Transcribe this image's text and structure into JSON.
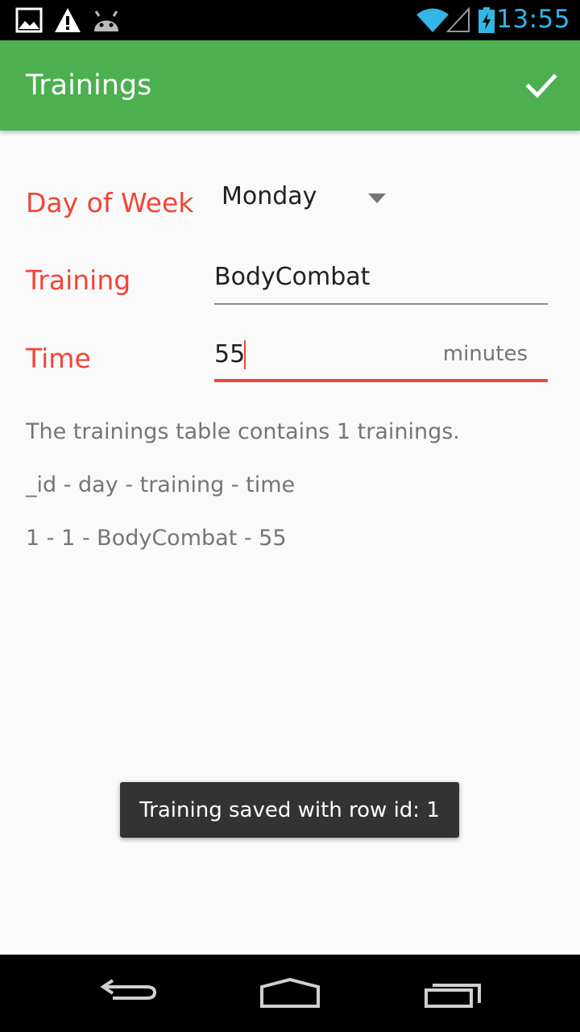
{
  "status_bar": {
    "time": "13:55",
    "icons": [
      "image-icon",
      "warning-icon",
      "android-debug-icon",
      "wifi-icon",
      "signal-icon",
      "battery-charging-icon"
    ],
    "time_color": "#33b5e5"
  },
  "app_bar": {
    "title": "Trainings",
    "color": "#4caf50",
    "save_icon": "checkmark-icon"
  },
  "form": {
    "day_label": "Day of Week",
    "day_value": "Monday",
    "training_label": "Training",
    "training_value": "BodyCombat",
    "time_label": "Time",
    "time_value": "55",
    "time_unit": "minutes",
    "label_color": "#f44336"
  },
  "info": {
    "summary": "The trainings table contains 1 trainings.",
    "header": "_id - day - training - time",
    "rows": [
      "1 - 1 - BodyCombat - 55"
    ]
  },
  "toast": {
    "text": "Training saved with row id: 1"
  },
  "nav_bar": {
    "icons": [
      "back-icon",
      "home-icon",
      "recents-icon"
    ]
  }
}
